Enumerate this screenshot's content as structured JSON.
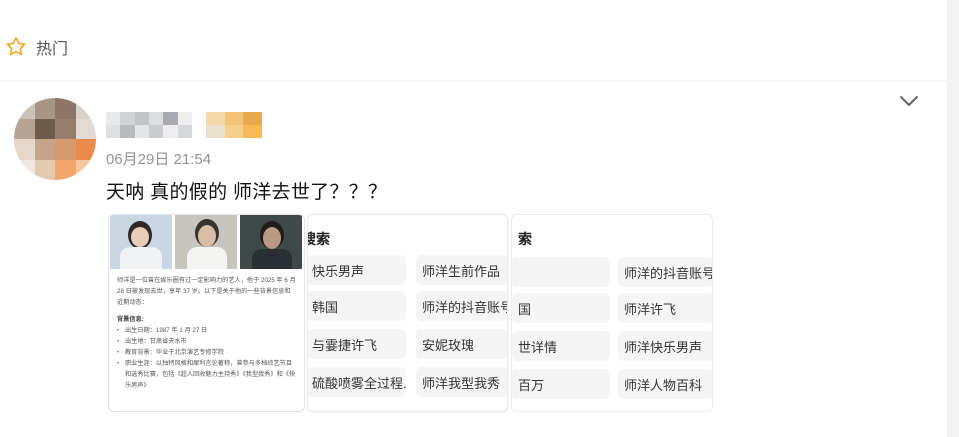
{
  "header": {
    "label": "热门",
    "icon": "star-outline-icon",
    "accent": "#f5a623"
  },
  "post": {
    "timestamp": "06月29日 21:54",
    "text": "天呐 真的假的 师洋去世了？？？",
    "menu_icon": "chevron-down-icon"
  },
  "image1": {
    "bio_intro": "师洋是一位曾在娱乐圈有过一定影响力的艺人，他于 2025 年 6 月 28 日被发现去世，享年 37 岁。以下是关于他的一些背景信息和近期动态：",
    "section_title": "背景信息:",
    "items": [
      "出生日期：1987 年 1 月 27 日",
      "出生地：甘肃省天水市",
      "教育背景：毕业于北京演艺专修学院",
      "职业生涯：以独特风格和犀利言论著称，曾参与多档综艺节目和选秀比赛，包括《超人回收魅力主持秀》《我型我秀》和《快乐男声》"
    ]
  },
  "image2": {
    "title": "搜索",
    "chips": [
      "快乐男声",
      "师洋生前作品",
      "韩国",
      "师洋的抖音账号",
      "与霎捷许飞",
      "安妮玫瑰",
      "硫酸喷雾全过程...",
      "师洋我型我秀"
    ]
  },
  "image3": {
    "title": "索",
    "chips": [
      "",
      "师洋的抖音账号",
      "国",
      "师洋许飞",
      "世详情",
      "师洋快乐男声",
      "百万",
      "师洋人物百科"
    ]
  }
}
